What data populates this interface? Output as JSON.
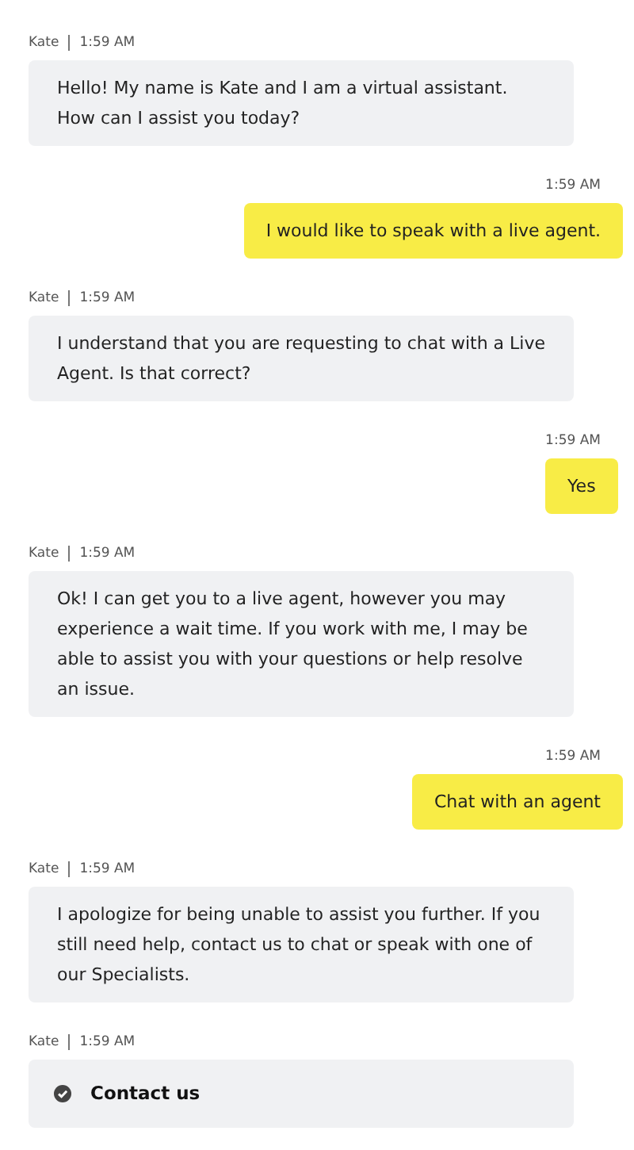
{
  "messages": [
    {
      "kind": "bot",
      "sender": "Kate",
      "time": "1:59 AM",
      "text": "Hello! My name is Kate and I am a virtual assistant. How can I assist you today?"
    },
    {
      "kind": "user",
      "time": "1:59 AM",
      "text": "I would like to speak with a live agent."
    },
    {
      "kind": "bot",
      "sender": "Kate",
      "time": "1:59 AM",
      "text": "I understand that you are requesting to chat with a Live Agent. Is that correct?"
    },
    {
      "kind": "user",
      "time": "1:59 AM",
      "text": "Yes"
    },
    {
      "kind": "bot",
      "sender": "Kate",
      "time": "1:59 AM",
      "text": "Ok! I can get you to a live agent, however you may experience a wait time. If you work with me, I may be able to assist you with your questions or help resolve an issue."
    },
    {
      "kind": "user",
      "time": "1:59 AM",
      "text": "Chat with an agent"
    },
    {
      "kind": "bot",
      "sender": "Kate",
      "time": "1:59 AM",
      "text": "I apologize for being unable to assist you further. If you still need help, contact us to chat or speak with one of our Specialists."
    },
    {
      "kind": "action",
      "sender": "Kate",
      "time": "1:59 AM",
      "text": "Contact us"
    }
  ]
}
